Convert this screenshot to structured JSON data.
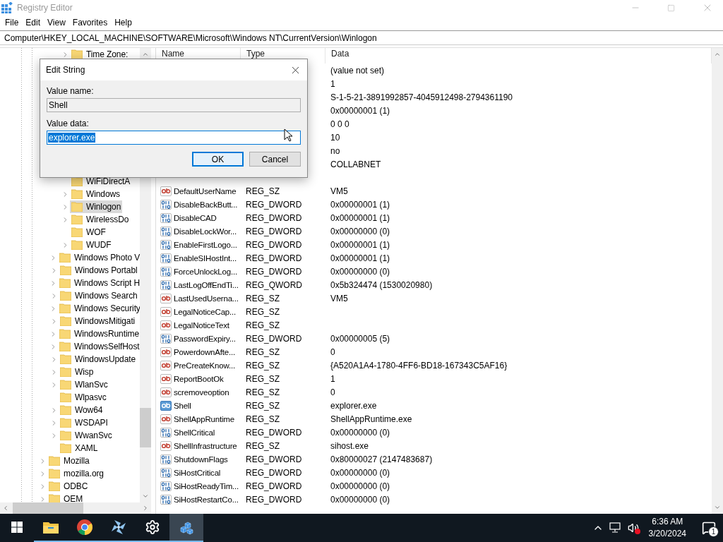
{
  "window": {
    "title": "Registry Editor"
  },
  "menu": [
    "File",
    "Edit",
    "View",
    "Favorites",
    "Help"
  ],
  "address": "Computer\\HKEY_LOCAL_MACHINE\\SOFTWARE\\Microsoft\\Windows NT\\CurrentVersion\\Winlogon",
  "tree": {
    "items": [
      {
        "children": [
          {
            "children": [
              {
                "label": "Time Zone:",
                "has_children": true,
                "selected": false
              },
              {
                "label": "WiFiDirectA",
                "has_children": false,
                "selected": false
              },
              {
                "label": "Windows",
                "has_children": true,
                "selected": false
              },
              {
                "label": "Winlogon",
                "has_children": true,
                "selected": true
              },
              {
                "label": "WirelessDo",
                "has_children": true,
                "selected": false
              },
              {
                "label": "WOF",
                "has_children": false,
                "selected": false
              },
              {
                "label": "WUDF",
                "has_children": true,
                "selected": false
              }
            ]
          },
          {
            "label": "Windows Photo V",
            "has_children": true,
            "selected": false
          },
          {
            "label": "Windows Portabl",
            "has_children": true,
            "selected": false
          },
          {
            "label": "Windows Script H",
            "has_children": true,
            "selected": false
          },
          {
            "label": "Windows Search",
            "has_children": true,
            "selected": false
          },
          {
            "label": "Windows Security",
            "has_children": true,
            "selected": false
          },
          {
            "label": "WindowsMitigati",
            "has_children": true,
            "selected": false
          },
          {
            "label": "WindowsRuntime",
            "has_children": true,
            "selected": false
          },
          {
            "label": "WindowsSelfHost",
            "has_children": true,
            "selected": false
          },
          {
            "label": "WindowsUpdate",
            "has_children": true,
            "selected": false
          },
          {
            "label": "Wisp",
            "has_children": true,
            "selected": false
          },
          {
            "label": "WlanSvc",
            "has_children": true,
            "selected": false
          },
          {
            "label": "Wlpasvc",
            "has_children": false,
            "selected": false
          },
          {
            "label": "Wow64",
            "has_children": true,
            "selected": false
          },
          {
            "label": "WSDAPI",
            "has_children": true,
            "selected": false
          },
          {
            "label": "WwanSvc",
            "has_children": true,
            "selected": false
          },
          {
            "label": "XAML",
            "has_children": false,
            "selected": false
          }
        ]
      },
      {
        "label": "Mozilla",
        "has_children": true,
        "selected": false
      },
      {
        "label": "mozilla.org",
        "has_children": true,
        "selected": false
      },
      {
        "label": "ODBC",
        "has_children": true,
        "selected": false
      },
      {
        "label": "OEM",
        "has_children": true,
        "selected": false
      }
    ]
  },
  "values": {
    "columns": [
      "Name",
      "Type",
      "Data"
    ],
    "rows": [
      {
        "data": "(value not set)"
      },
      {
        "data": "1"
      },
      {
        "data": "S-1-5-21-3891992857-4045912498-2794361190"
      },
      {
        "data": "0x00000001 (1)"
      },
      {
        "data": "0 0 0"
      },
      {
        "data": "10"
      },
      {
        "data": "no"
      },
      {
        "data": "COLLABNET"
      },
      {
        "kind": "string",
        "name": "DefaultUserName",
        "type": "REG_SZ",
        "data": "VM5",
        "selected": false
      },
      {
        "kind": "number",
        "name": "DisableBackButt...",
        "type": "REG_DWORD",
        "data": "0x00000001 (1)",
        "selected": false
      },
      {
        "kind": "number",
        "name": "DisableCAD",
        "type": "REG_DWORD",
        "data": "0x00000001 (1)",
        "selected": false
      },
      {
        "kind": "number",
        "name": "DisableLockWor...",
        "type": "REG_DWORD",
        "data": "0x00000000 (0)",
        "selected": false
      },
      {
        "kind": "number",
        "name": "EnableFirstLogo...",
        "type": "REG_DWORD",
        "data": "0x00000001 (1)",
        "selected": false
      },
      {
        "kind": "number",
        "name": "EnableSIHostInt...",
        "type": "REG_DWORD",
        "data": "0x00000001 (1)",
        "selected": false
      },
      {
        "kind": "number",
        "name": "ForceUnlockLog...",
        "type": "REG_DWORD",
        "data": "0x00000000 (0)",
        "selected": false
      },
      {
        "kind": "number",
        "name": "LastLogOffEndTi...",
        "type": "REG_QWORD",
        "data": "0x5b324474 (1530020980)",
        "selected": false
      },
      {
        "kind": "string",
        "name": "LastUsedUserna...",
        "type": "REG_SZ",
        "data": "VM5",
        "selected": false
      },
      {
        "kind": "string",
        "name": "LegalNoticeCap...",
        "type": "REG_SZ",
        "selected": false
      },
      {
        "kind": "string",
        "name": "LegalNoticeText",
        "type": "REG_SZ",
        "selected": false
      },
      {
        "kind": "number",
        "name": "PasswordExpiry...",
        "type": "REG_DWORD",
        "data": "0x00000005 (5)",
        "selected": false
      },
      {
        "kind": "string",
        "name": "PowerdownAfte...",
        "type": "REG_SZ",
        "data": "0",
        "selected": false
      },
      {
        "kind": "string",
        "name": "PreCreateKnow...",
        "type": "REG_SZ",
        "data": "{A520A1A4-1780-4FF6-BD18-167343C5AF16}",
        "selected": false
      },
      {
        "kind": "string",
        "name": "ReportBootOk",
        "type": "REG_SZ",
        "data": "1",
        "selected": false
      },
      {
        "kind": "string",
        "name": "scremoveoption",
        "type": "REG_SZ",
        "data": "0",
        "selected": false
      },
      {
        "kind": "string",
        "name": "Shell",
        "type": "REG_SZ",
        "data": "explorer.exe",
        "selected": true
      },
      {
        "kind": "string",
        "name": "ShellAppRuntime",
        "type": "REG_SZ",
        "data": "ShellAppRuntime.exe",
        "selected": false
      },
      {
        "kind": "number",
        "name": "ShellCritical",
        "type": "REG_DWORD",
        "data": "0x00000000 (0)",
        "selected": false
      },
      {
        "kind": "string",
        "name": "ShellInfrastructure",
        "type": "REG_SZ",
        "data": "sihost.exe",
        "selected": false
      },
      {
        "kind": "number",
        "name": "ShutdownFlags",
        "type": "REG_DWORD",
        "data": "0x80000027 (2147483687)",
        "selected": false
      },
      {
        "kind": "number",
        "name": "SiHostCritical",
        "type": "REG_DWORD",
        "data": "0x00000000 (0)",
        "selected": false
      },
      {
        "kind": "number",
        "name": "SiHostReadyTim...",
        "type": "REG_DWORD",
        "data": "0x00000000 (0)",
        "selected": false
      },
      {
        "kind": "number",
        "name": "SiHostRestartCo...",
        "type": "REG_DWORD",
        "data": "0x00000000 (0)",
        "selected": false
      }
    ]
  },
  "dialog": {
    "title": "Edit String",
    "name_label": "Value name:",
    "name_value": "Shell",
    "data_label": "Value data:",
    "data_value": "explorer.exe",
    "data_selected": true,
    "buttons": [
      {
        "label": "OK",
        "default": true
      },
      {
        "label": "Cancel",
        "default": false
      }
    ]
  },
  "taskbar": {
    "apps": [
      {
        "kind": "folder",
        "running": true,
        "active": false
      },
      {
        "kind": "browser",
        "running": true,
        "active": false
      },
      {
        "kind": "pinwheel",
        "running": true,
        "active": false
      },
      {
        "kind": "settings",
        "running": true,
        "active": false
      },
      {
        "kind": "registry",
        "running": true,
        "active": true
      }
    ],
    "time": "6:36 AM",
    "date": "3/20/2024",
    "notifications": "1"
  }
}
